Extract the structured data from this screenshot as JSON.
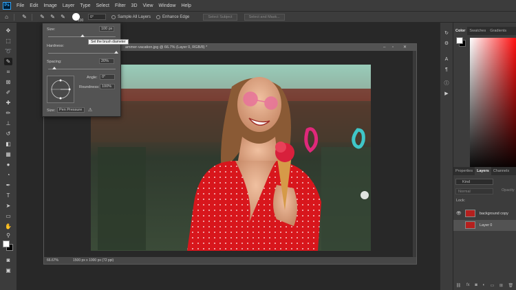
{
  "menu": {
    "logo": "Ps",
    "items": [
      "File",
      "Edit",
      "Image",
      "Layer",
      "Type",
      "Select",
      "Filter",
      "3D",
      "View",
      "Window",
      "Help"
    ]
  },
  "options": {
    "brush_size_number": "100",
    "angle": "0°",
    "sample_all_layers": "Sample All Layers",
    "enhance_edge": "Enhance Edge",
    "select_subject": "Select Subject",
    "select_and_mask": "Select and Mask..."
  },
  "brush_popup": {
    "size_label": "Size:",
    "size_value": "100 px",
    "hardness_label": "Hardness:",
    "spacing_label": "Spacing:",
    "spacing_value": "20%",
    "angle_label": "Angle:",
    "angle_value": "0°",
    "roundness_label": "Roundness:",
    "roundness_value": "100%",
    "size_control_label": "Size:",
    "size_control_value": "Pen Pressure",
    "tooltip": "Set the brush diameter"
  },
  "document": {
    "title": "ammer-vacation.jpg @ 66.7% (Layer 0, RGB/8) *",
    "zoom": "66.67%",
    "doc_info": "1500 px x 1000 px (72 ppi)"
  },
  "panels": {
    "color_tabs": [
      "Color",
      "Swatches",
      "Gradients"
    ],
    "layer_tabs": [
      "Properties",
      "Layers",
      "Channels"
    ],
    "kind_label": "Kind",
    "blend_mode": "Normal",
    "opacity_label": "Opacity",
    "lock_label": "Lock:",
    "layers": [
      {
        "name": "background copy",
        "selected": false,
        "visible": true
      },
      {
        "name": "Layer 0",
        "selected": true,
        "visible": false
      }
    ]
  },
  "colors": {
    "accent": "#31a8ff",
    "panel_bg": "#3c3c3c",
    "canvas_bg": "#282828"
  }
}
